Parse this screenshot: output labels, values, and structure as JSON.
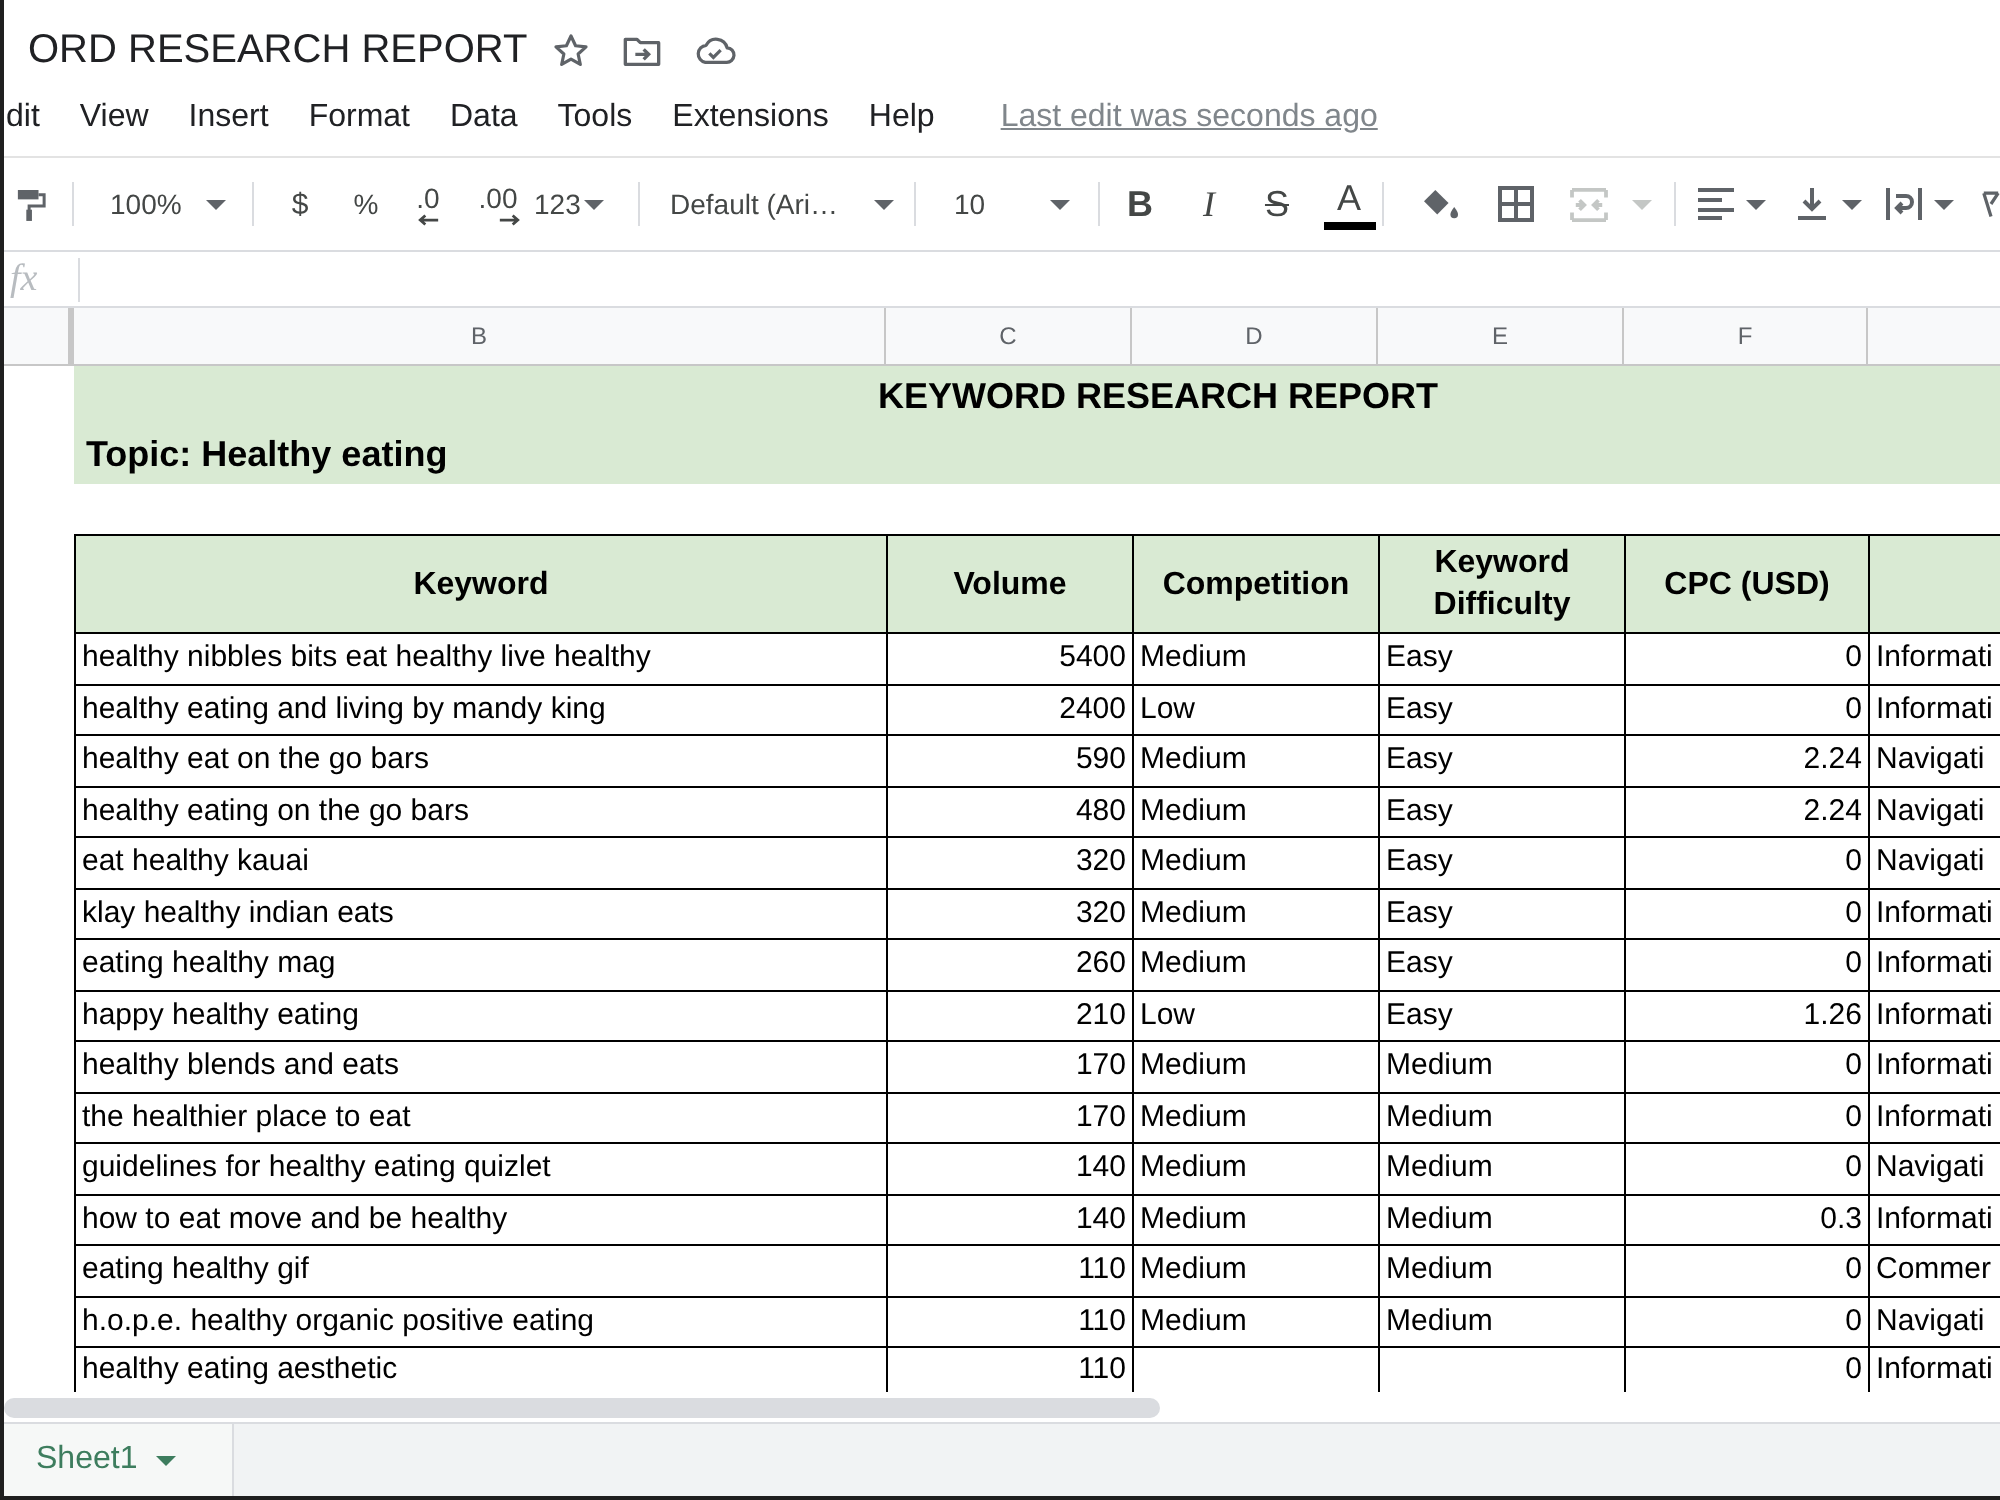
{
  "document": {
    "title": "ORD RESEARCH REPORT"
  },
  "menu": {
    "items": [
      "dit",
      "View",
      "Insert",
      "Format",
      "Data",
      "Tools",
      "Extensions",
      "Help"
    ],
    "last_edit": "Last edit was seconds ago"
  },
  "toolbar": {
    "zoom": "100%",
    "currency": "$",
    "percent": "%",
    "decrease_decimals": ".0",
    "increase_decimals": ".00",
    "number_format": "123",
    "font": "Default (Ari…",
    "font_size": "10",
    "bold": "B",
    "italic": "I",
    "strikethrough": "S",
    "text_color": "A",
    "merge_cells": {
      "disabled": true
    }
  },
  "formula_bar": {
    "label": "fx"
  },
  "column_headers": [
    "B",
    "C",
    "D",
    "E",
    "F"
  ],
  "report": {
    "title": "KEYWORD RESEARCH REPORT",
    "topic": "Topic: Healthy eating"
  },
  "table": {
    "columns": [
      "Keyword",
      "Volume",
      "Competition",
      "Keyword Difficulty",
      "CPC (USD)"
    ],
    "rows": [
      {
        "keyword": "healthy nibbles bits eat healthy live healthy",
        "volume": "5400",
        "competition": "Medium",
        "difficulty": "Easy",
        "cpc": "0",
        "column_6": "Informati"
      },
      {
        "keyword": "healthy eating and living by mandy king",
        "volume": "2400",
        "competition": "Low",
        "difficulty": "Easy",
        "cpc": "0",
        "column_6": "Informati"
      },
      {
        "keyword": "healthy eat on the go bars",
        "volume": "590",
        "competition": "Medium",
        "difficulty": "Easy",
        "cpc": "2.24",
        "column_6": "Navigati"
      },
      {
        "keyword": "healthy eating on the go bars",
        "volume": "480",
        "competition": "Medium",
        "difficulty": "Easy",
        "cpc": "2.24",
        "column_6": "Navigati"
      },
      {
        "keyword": "eat healthy kauai",
        "volume": "320",
        "competition": "Medium",
        "difficulty": "Easy",
        "cpc": "0",
        "column_6": "Navigati"
      },
      {
        "keyword": "klay healthy indian eats",
        "volume": "320",
        "competition": "Medium",
        "difficulty": "Easy",
        "cpc": "0",
        "column_6": "Informati"
      },
      {
        "keyword": "eating healthy mag",
        "volume": "260",
        "competition": "Medium",
        "difficulty": "Easy",
        "cpc": "0",
        "column_6": "Informati"
      },
      {
        "keyword": "happy healthy eating",
        "volume": "210",
        "competition": "Low",
        "difficulty": "Easy",
        "cpc": "1.26",
        "column_6": "Informati"
      },
      {
        "keyword": "healthy blends and eats",
        "volume": "170",
        "competition": "Medium",
        "difficulty": "Medium",
        "cpc": "0",
        "column_6": "Informati"
      },
      {
        "keyword": "the healthier place to eat",
        "volume": "170",
        "competition": "Medium",
        "difficulty": "Medium",
        "cpc": "0",
        "column_6": "Informati"
      },
      {
        "keyword": "guidelines for healthy eating quizlet",
        "volume": "140",
        "competition": "Medium",
        "difficulty": "Medium",
        "cpc": "0",
        "column_6": "Navigati"
      },
      {
        "keyword": "how to eat move and be healthy",
        "volume": "140",
        "competition": "Medium",
        "difficulty": "Medium",
        "cpc": "0.3",
        "column_6": "Informati"
      },
      {
        "keyword": "eating healthy gif",
        "volume": "110",
        "competition": "Medium",
        "difficulty": "Medium",
        "cpc": "0",
        "column_6": "Commer"
      },
      {
        "keyword": "h.o.p.e. healthy organic positive eating",
        "volume": "110",
        "competition": "Medium",
        "difficulty": "Medium",
        "cpc": "0",
        "column_6": "Navigati"
      },
      {
        "keyword": "healthy eating aesthetic",
        "volume": "110",
        "cpc": "0",
        "column_6": "Informati"
      }
    ]
  },
  "sheet_tabs": [
    {
      "label": "Sheet1",
      "selected": true
    }
  ]
}
